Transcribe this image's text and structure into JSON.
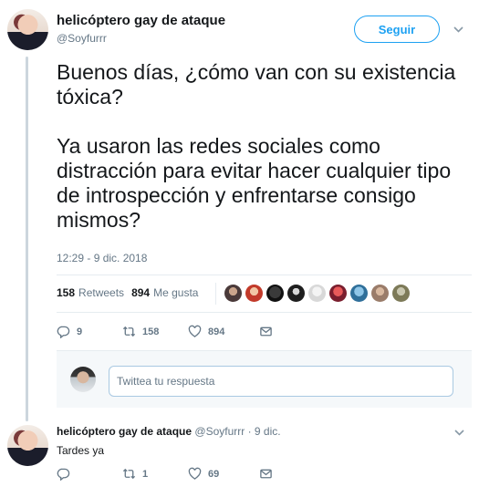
{
  "tweet": {
    "author_name": "helicóptero gay de ataque",
    "author_handle": "@Soyfurrr",
    "follow_label": "Seguir",
    "text_p1": "Buenos días, ¿cómo van con su existencia tóxica?",
    "text_p2": "Ya usaron las redes sociales como distracción para evitar hacer cualquier tipo de introspección y enfrentarse consigo mismos?",
    "timestamp": "12:29 - 9 dic. 2018",
    "retweets_count": "158",
    "retweets_label": "Retweets",
    "likes_count": "894",
    "likes_label": "Me gusta",
    "actions": {
      "replies": "9",
      "retweets": "158",
      "likes": "894"
    }
  },
  "compose": {
    "placeholder": "Twittea tu respuesta"
  },
  "reply": {
    "author_name": "helicóptero gay de ataque",
    "author_handle": "@Soyfurrr",
    "separator": " · ",
    "date": "9 dic.",
    "text": "Tardes ya",
    "actions": {
      "replies": "",
      "retweets": "1",
      "likes": "69"
    }
  },
  "icons": [
    "reply-icon",
    "retweet-icon",
    "like-icon",
    "message-icon",
    "chevron-down-icon"
  ],
  "colors": {
    "accent": "#1da1f2",
    "muted": "#657786",
    "divider": "#e6ecf0"
  }
}
